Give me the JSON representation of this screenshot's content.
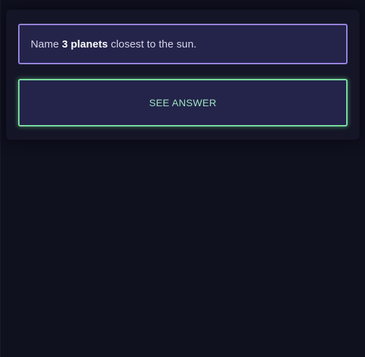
{
  "question": {
    "prefix": "Name ",
    "emphasis": "3 planets",
    "suffix": " closest to the sun."
  },
  "answer_button": {
    "label": "SEE ANSWER"
  },
  "colors": {
    "background": "#10111f",
    "card": "#24244b",
    "question_border": "#9b86e0",
    "button_border": "#7ee0a1",
    "button_text": "#9fe4bf"
  }
}
